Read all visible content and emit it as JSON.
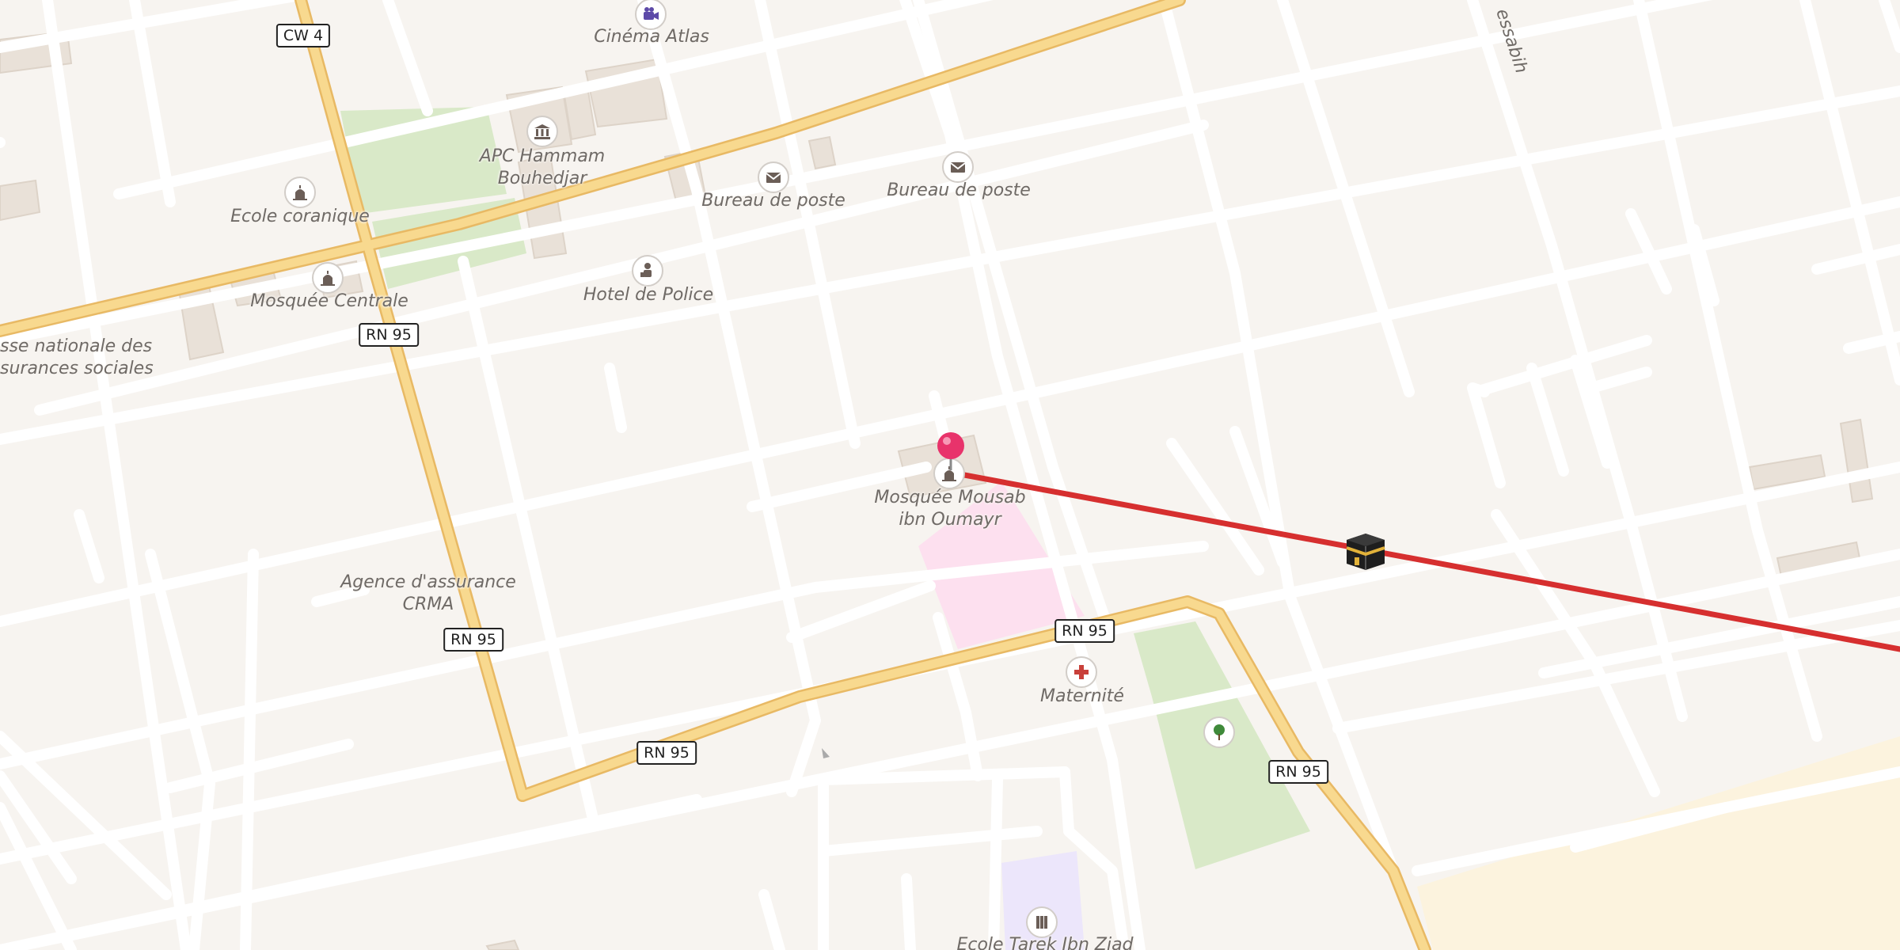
{
  "map": {
    "colors": {
      "background": "#f7f4f0",
      "minor_road": "#ffffff",
      "main_road": "#f8d98f",
      "main_road_casing": "#e8b964",
      "park": "#d9e9c8",
      "hospital_area": "#fde0ef",
      "school_area": "#ece6fb",
      "building": "#e9e1d8",
      "route_line": "#d62f2f",
      "pin": "#e8336b",
      "poi_icon": "#6b5e57"
    },
    "road_shields": [
      "CW 4",
      "RN 95",
      "RN 95",
      "RN 95",
      "RN 95",
      "RN 95"
    ],
    "street_name": "essabih",
    "places": [
      {
        "name": "Cinéma Atlas",
        "icon": "cinema-icon"
      },
      {
        "name": "APC Hammam\nBouhedjar",
        "icon": "town-hall-icon"
      },
      {
        "name": "Ecole coranique",
        "icon": "mosque-icon"
      },
      {
        "name": "Bureau de poste",
        "icon": "post-office-icon"
      },
      {
        "name": "Bureau de poste",
        "icon": "post-office-icon"
      },
      {
        "name": "Mosquée Centrale",
        "icon": "mosque-icon"
      },
      {
        "name": "Hotel de Police",
        "icon": "police-icon"
      },
      {
        "name": "Caisse nationale des\nassurances sociales",
        "icon": ""
      },
      {
        "name": "Mosquée Mousab\nibn Oumayr",
        "icon": "mosque-icon"
      },
      {
        "name": "Agence d'assurance\nCRMA",
        "icon": ""
      },
      {
        "name": "Maternité",
        "icon": "hospital-icon"
      },
      {
        "name": "",
        "icon": "park-tree-icon"
      },
      {
        "name": "Ecole Tarek Ibn Ziad",
        "icon": "school-icon"
      }
    ],
    "labels_cropped": {
      "street_name": "essabih",
      "cnas_visible": "sse nationale des\nsurances sociales",
      "school_visible": "Ecole Tarek Ibn Ziad"
    },
    "markers": {
      "selected_pin": "location-pin-icon",
      "qibla_marker": "kaaba-icon"
    },
    "route": {
      "name": "qibla-direction-line"
    }
  }
}
